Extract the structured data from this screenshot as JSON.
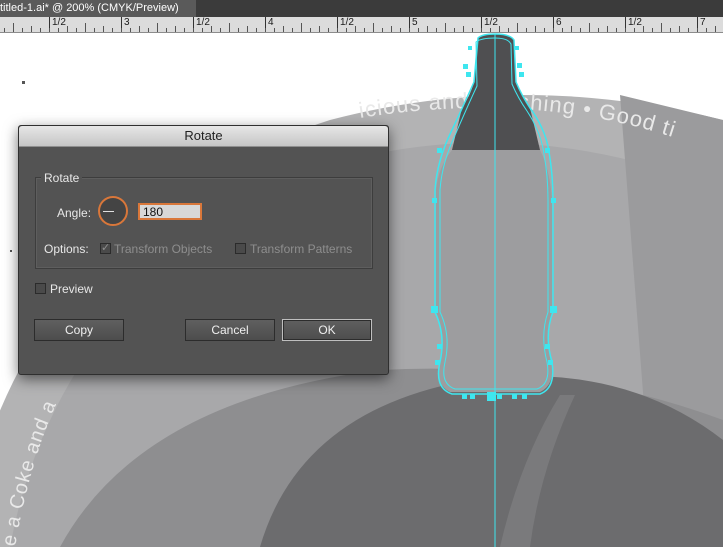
{
  "window": {
    "tab_title": "titled-1.ai* @ 200% (CMYK/Preview)"
  },
  "ruler": {
    "labels": [
      "1/2",
      "3",
      "1/2",
      "4",
      "1/2",
      "5",
      "1/2",
      "6",
      "1/2",
      "7"
    ]
  },
  "artwork": {
    "ring_text_top": "icious and  efreshing • Good ti",
    "ring_text_left": "e a Coke and a",
    "selection_color": "#3ee6ef"
  },
  "dialog": {
    "title": "Rotate",
    "group_label": "Rotate",
    "angle_label": "Angle:",
    "angle_value": "180",
    "options_label": "Options:",
    "transform_objects_label": "Transform Objects",
    "transform_objects_checked": true,
    "transform_patterns_label": "Transform Patterns",
    "transform_patterns_checked": false,
    "preview_label": "Preview",
    "preview_checked": false,
    "copy_label": "Copy",
    "cancel_label": "Cancel",
    "ok_label": "OK",
    "accent_color": "#d9773a"
  },
  "icons": {
    "angle_dial": "angle-dial-icon",
    "checkmark": "checkmark-icon"
  }
}
